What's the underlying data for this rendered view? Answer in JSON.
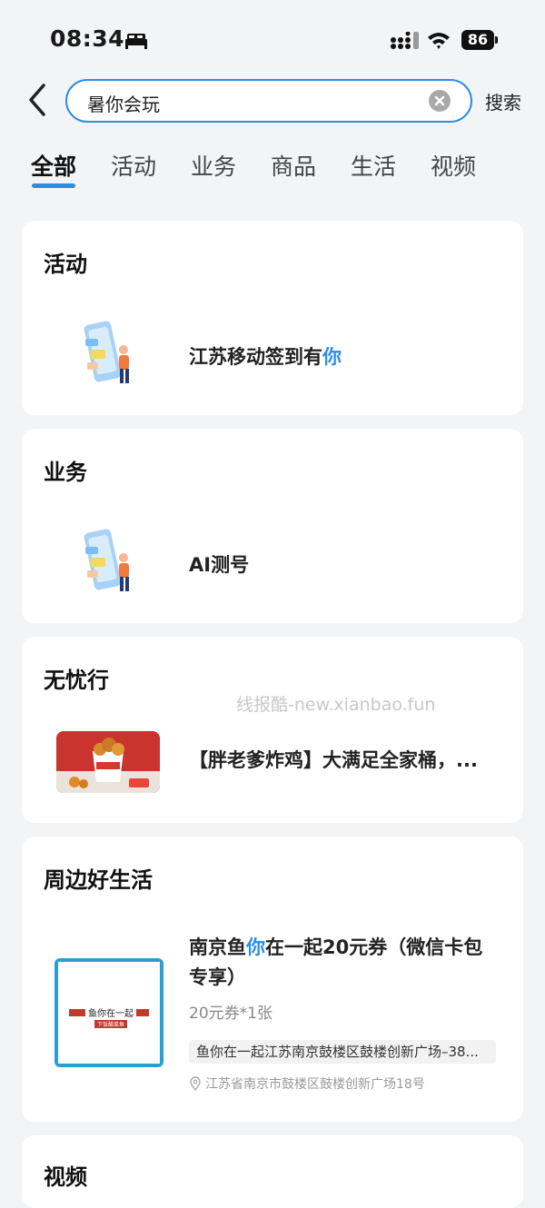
{
  "status_bar": {
    "time": "08:34",
    "battery": "86"
  },
  "search": {
    "query": "暑你会玩",
    "button_label": "搜索"
  },
  "tabs": [
    {
      "label": "全部"
    },
    {
      "label": "活动"
    },
    {
      "label": "业务"
    },
    {
      "label": "商品"
    },
    {
      "label": "生活"
    },
    {
      "label": "视频"
    }
  ],
  "active_tab": "全部",
  "sections": {
    "activity": {
      "title": "活动",
      "item": {
        "title_prefix": "江苏移动签到有",
        "title_highlight": "你"
      }
    },
    "business": {
      "title": "业务",
      "item": {
        "title": "AI测号"
      }
    },
    "worry_free": {
      "title": "无忧行",
      "watermark": "线报酷-new.xianbao.fun",
      "item": {
        "title": "【胖老爹炸鸡】大满足全家桶，..."
      }
    },
    "life": {
      "title": "周边好生活",
      "item": {
        "title_a": "南京鱼",
        "title_highlight": "你",
        "title_b": "在一起20元券（微信卡包专享）",
        "subtitle": "20元券*1张",
        "store_address": "鱼你在一起江苏南京鼓楼区鼓楼创新广场–38...",
        "location": "江苏省南京市鼓楼区鼓楼创新广场18号",
        "logo_text": "鱼你在一起",
        "logo_sub": "下饭酸菜鱼"
      }
    },
    "video": {
      "title": "视频"
    }
  },
  "colors": {
    "accent": "#2b8de8",
    "background": "#f3f4f6"
  }
}
